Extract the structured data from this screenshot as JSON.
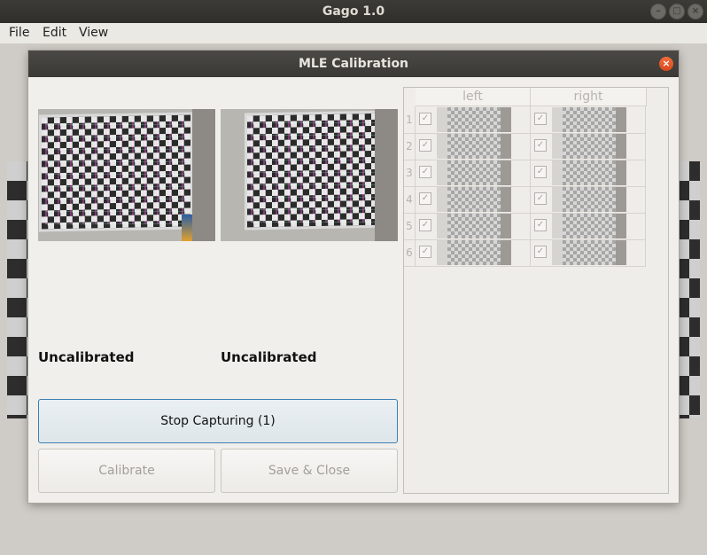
{
  "window": {
    "title": "Gago 1.0",
    "controls": [
      "–",
      "□",
      "×"
    ]
  },
  "menu": [
    "File",
    "Edit",
    "View"
  ],
  "dialog": {
    "title": "MLE Calibration",
    "close_glyph": "×",
    "left_status": "Uncalibrated",
    "right_status": "Uncalibrated",
    "stop_button": "Stop Capturing (1)",
    "calibrate_button": "Calibrate",
    "save_close_button": "Save & Close"
  },
  "table": {
    "headers": [
      "left",
      "right"
    ],
    "rows": [
      {
        "num": "1",
        "left_checked": true,
        "right_checked": true
      },
      {
        "num": "2",
        "left_checked": true,
        "right_checked": true
      },
      {
        "num": "3",
        "left_checked": true,
        "right_checked": true
      },
      {
        "num": "4",
        "left_checked": true,
        "right_checked": true
      },
      {
        "num": "5",
        "left_checked": true,
        "right_checked": true
      },
      {
        "num": "6",
        "left_checked": true,
        "right_checked": true
      }
    ],
    "check_glyph": "✓"
  },
  "colors": {
    "accent": "#3c7fb1",
    "close_button": "#e35a26",
    "titlebar": "#3c3b37"
  },
  "icons": {
    "close": "close-icon",
    "minimize": "minimize-icon",
    "maximize": "maximize-icon"
  }
}
